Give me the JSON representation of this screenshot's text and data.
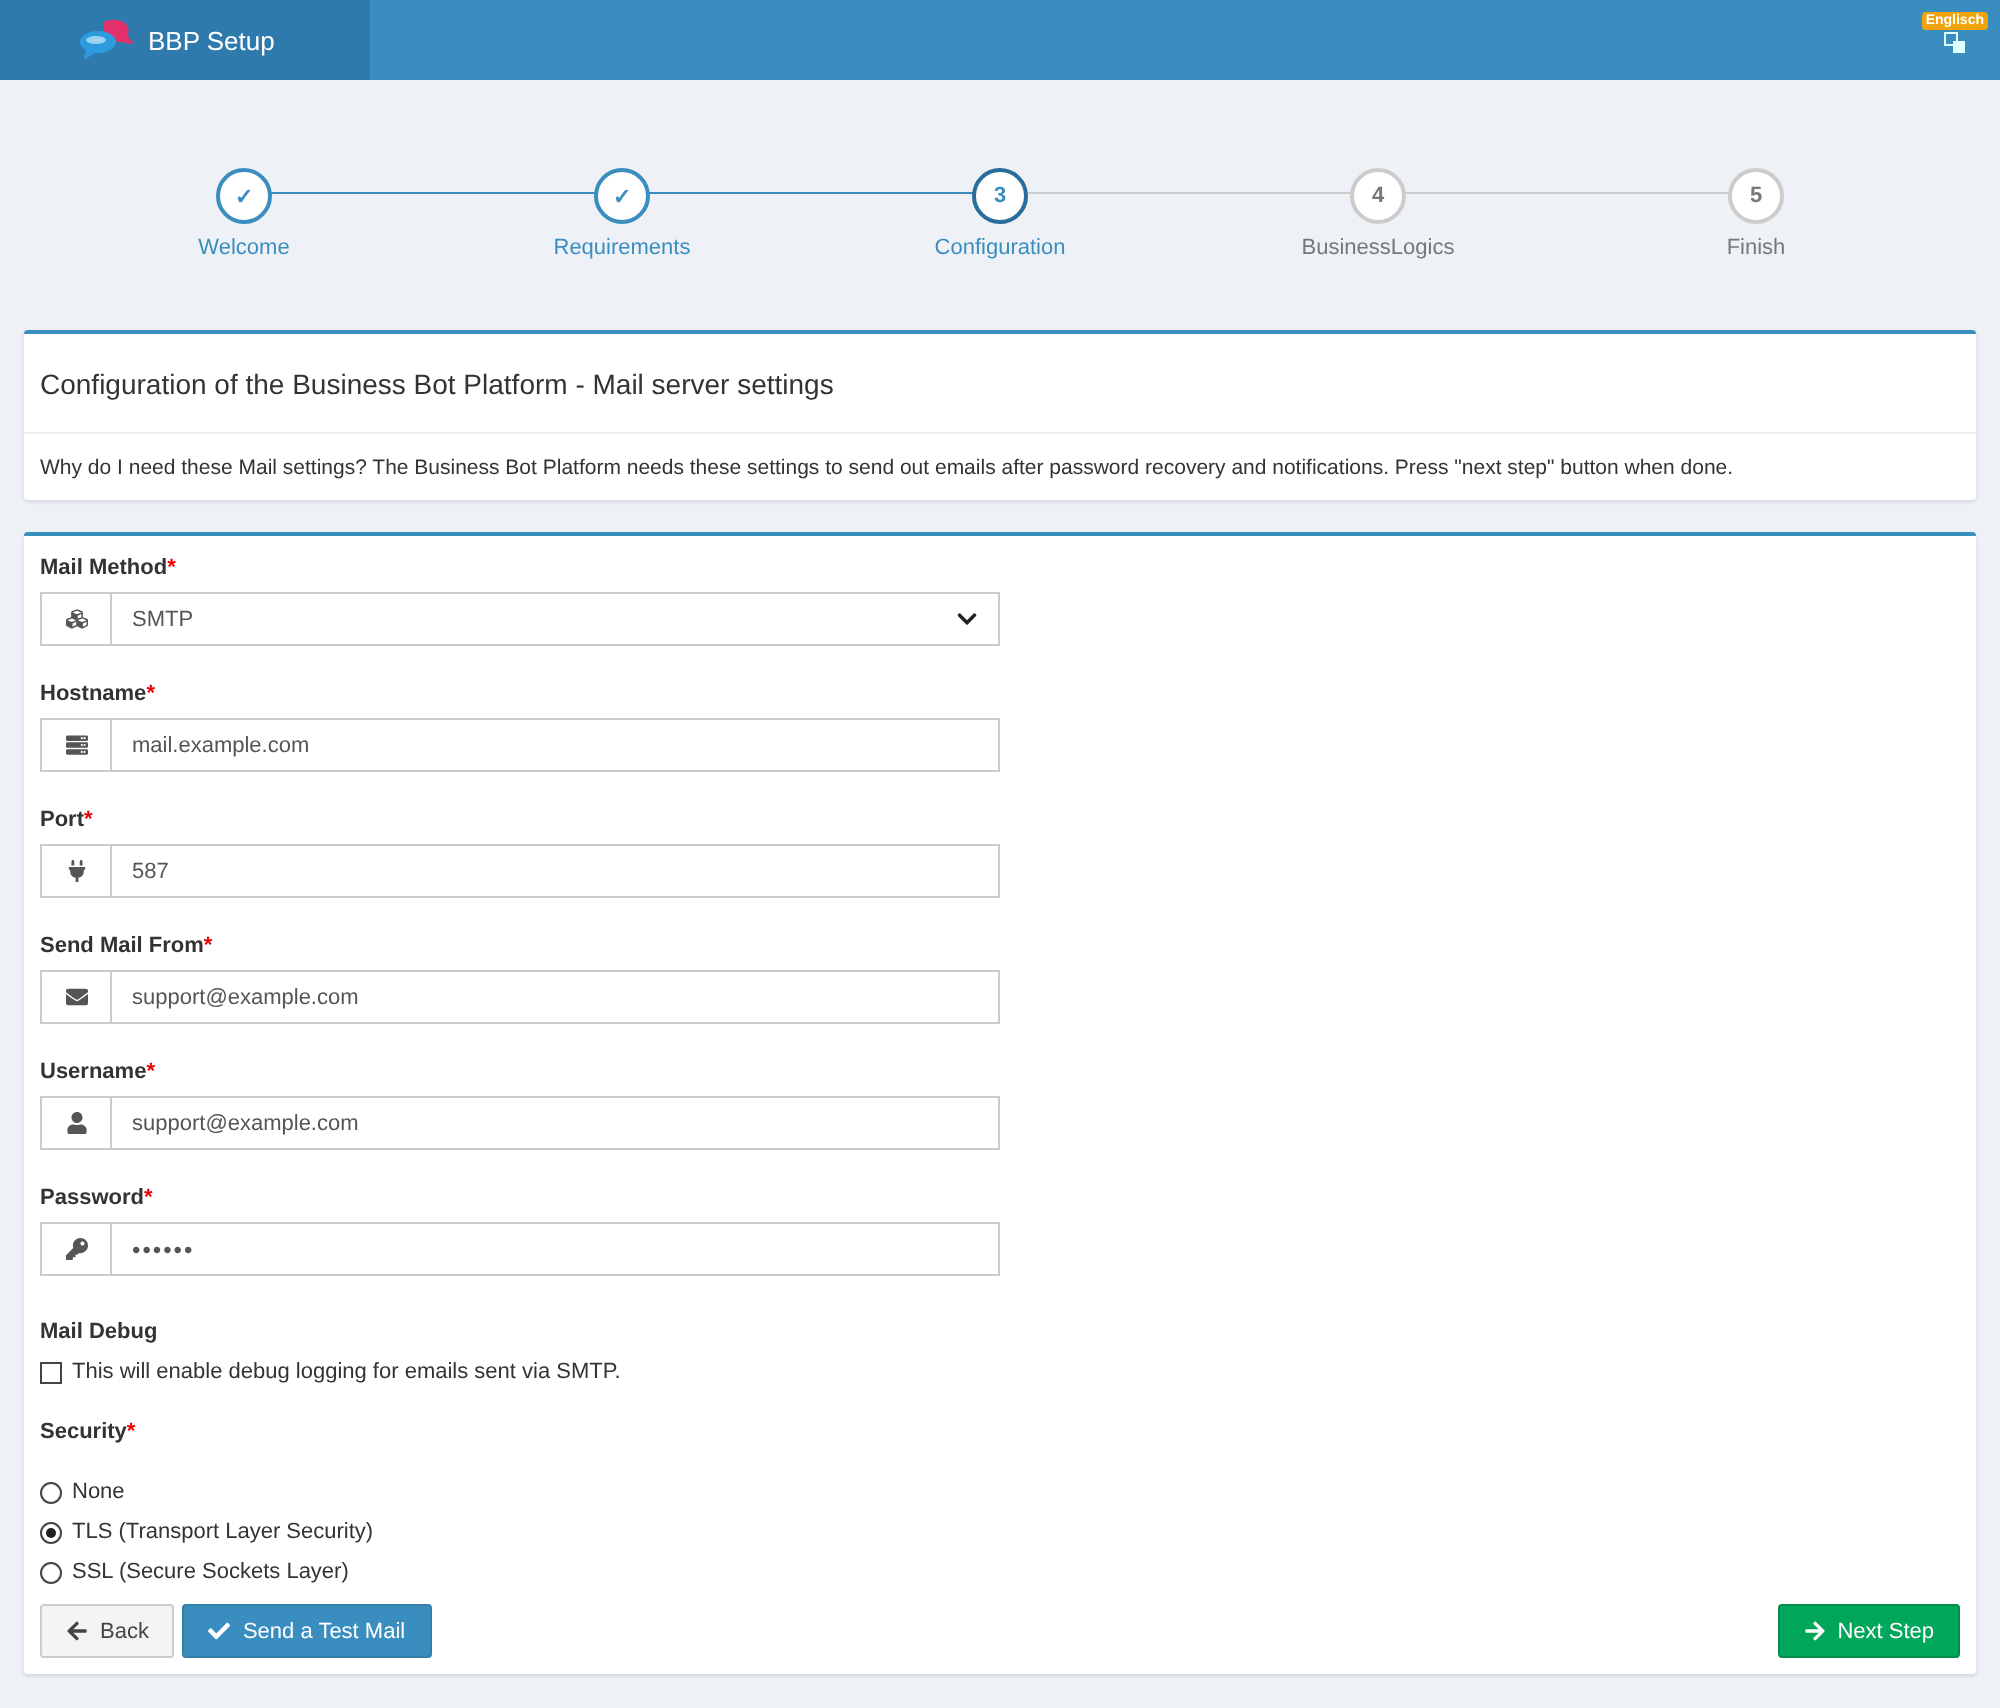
{
  "header": {
    "title": "BBP Setup",
    "language": "Englisch"
  },
  "steps": [
    {
      "marker": "✓",
      "label": "Welcome",
      "done": true,
      "selected": false
    },
    {
      "marker": "✓",
      "label": "Requirements",
      "done": true,
      "selected": false
    },
    {
      "marker": "3",
      "label": "Configuration",
      "done": false,
      "selected": true
    },
    {
      "marker": "4",
      "label": "BusinessLogics",
      "done": false,
      "selected": false
    },
    {
      "marker": "5",
      "label": "Finish",
      "done": false,
      "selected": false
    }
  ],
  "intro": {
    "title": "Configuration of the Business Bot Platform - Mail server settings",
    "text": "Why do I need these Mail settings? The Business Bot Platform needs these settings to send out emails after password recovery and notifications. Press \"next step\" button when done."
  },
  "fields": [
    {
      "label": "Mail Method",
      "required_mark": "*",
      "kind": "select",
      "value": "SMTP"
    },
    {
      "label": "Hostname",
      "required_mark": "*",
      "kind": "text",
      "value": "mail.example.com"
    },
    {
      "label": "Port",
      "required_mark": "*",
      "kind": "text",
      "value": "587"
    },
    {
      "label": "Send Mail From",
      "required_mark": "*",
      "kind": "text",
      "value": "support@example.com"
    },
    {
      "label": "Username",
      "required_mark": "*",
      "kind": "text",
      "value": "support@example.com"
    },
    {
      "label": "Password",
      "required_mark": "*",
      "kind": "password",
      "value": "••••••"
    }
  ],
  "mail_debug": {
    "label": "Mail Debug",
    "checkbox_label": "This will enable debug logging for emails sent via SMTP.",
    "checked": false
  },
  "security": {
    "label": "Security",
    "required_mark": "*",
    "options": [
      {
        "label": "None",
        "selected": false
      },
      {
        "label": "TLS (Transport Layer Security)",
        "selected": true
      },
      {
        "label": "SSL (Secure Sockets Layer)",
        "selected": false
      }
    ]
  },
  "buttons": [
    {
      "label": "Back",
      "kind": "back"
    },
    {
      "label": "Send a Test Mail",
      "kind": "test"
    },
    {
      "label": "Next Step",
      "kind": "next"
    }
  ]
}
